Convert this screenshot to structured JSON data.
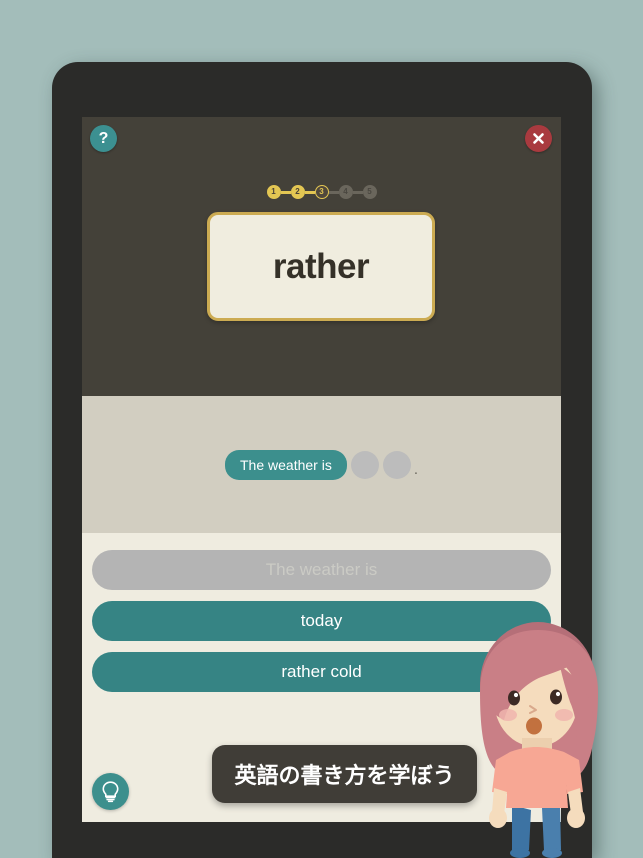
{
  "background": {
    "color": "#a3bdba"
  },
  "device": {
    "bezel_color": "#2b2b29"
  },
  "prompt_panel": {
    "background": "#444139",
    "help_button": {
      "icon": "question-mark-icon",
      "label": "?",
      "color": "#3c9091"
    },
    "close_button": {
      "icon": "close-x-icon",
      "label": "×",
      "color": "#a93a3f"
    },
    "word_card": {
      "word": "rather",
      "background": "#f0eddf",
      "border_color": "#ccab52",
      "text_color": "#353128"
    },
    "progress": {
      "current_step": 3,
      "total_steps": 5,
      "active_color": "#e3c653",
      "inactive_color": "#6a665c",
      "steps": [
        {
          "label": "1",
          "state": "done"
        },
        {
          "label": "2",
          "state": "done"
        },
        {
          "label": "3",
          "state": "current"
        },
        {
          "label": "4",
          "state": "todo"
        },
        {
          "label": "5",
          "state": "todo"
        }
      ]
    }
  },
  "answer_area": {
    "background": "#d2cec1",
    "chips": [
      {
        "text": "The weather is",
        "filled": true,
        "color": "#3c8f8d"
      }
    ],
    "empty_slots": 2,
    "slot_color": "#bcbcbc",
    "trailing_punctuation": "."
  },
  "options_area": {
    "background": "#efece0",
    "options": [
      {
        "label": "The weather is",
        "state": "used",
        "color": "#b4b4b4"
      },
      {
        "label": "today",
        "state": "active",
        "color": "#368484"
      },
      {
        "label": "rather cold",
        "state": "active",
        "color": "#368484"
      }
    ],
    "hint_button": {
      "icon": "lightbulb-icon",
      "color": "#3c8f8d"
    }
  },
  "tooltip": {
    "text": "英語の書き方を学ぼう",
    "background": "#403d37",
    "text_color": "#ffffff"
  },
  "mascot": {
    "name": "girl-character",
    "hair_color": "#c97f86",
    "skin_color": "#f5dcbd",
    "shirt_color": "#f7a794",
    "pants_color": "#4a7fad"
  }
}
